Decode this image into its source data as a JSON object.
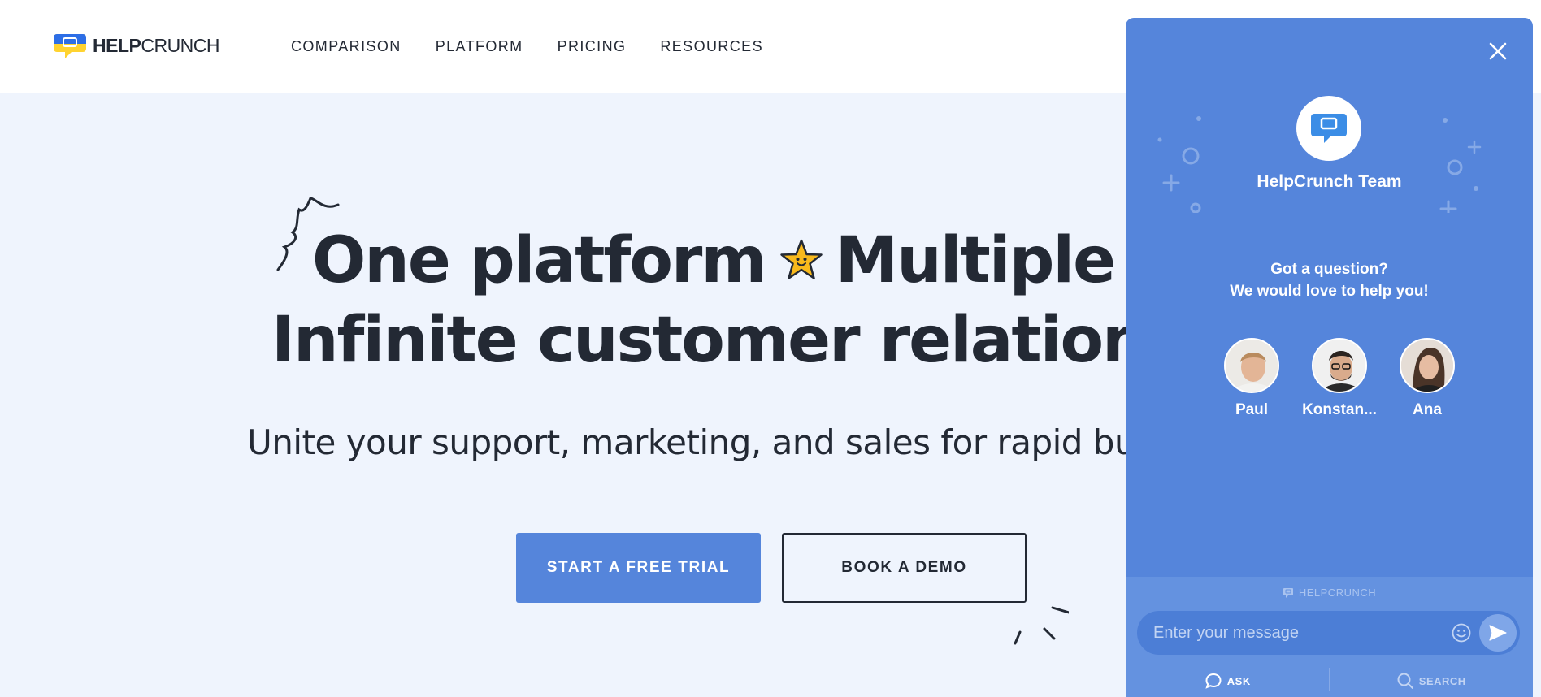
{
  "header": {
    "logo_bold": "HELP",
    "logo_light": "CRUNCH",
    "nav": [
      {
        "label": "COMPARISON"
      },
      {
        "label": "PLATFORM"
      },
      {
        "label": "PRICING"
      },
      {
        "label": "RESOURCES"
      }
    ]
  },
  "hero": {
    "title_line1_a": "One platform",
    "title_line1_b": "Multiple to",
    "title_line2": "Infinite customer relationsh",
    "subtitle": "Unite your support, marketing, and sales for rapid busine",
    "primary_cta": "START A FREE TRIAL",
    "secondary_cta": "BOOK A DEMO"
  },
  "widget": {
    "team_name": "HelpCrunch Team",
    "question_line1": "Got a question?",
    "question_line2": "We would love to help you!",
    "agents": [
      {
        "name": "Paul"
      },
      {
        "name": "Konstan..."
      },
      {
        "name": "Ana"
      }
    ],
    "powered_by": "HELPCRUNCH",
    "message_placeholder": "Enter your message",
    "tabs": {
      "ask": "ASK",
      "search": "SEARCH"
    }
  },
  "colors": {
    "brand_blue": "#5585db",
    "text_dark": "#232934",
    "hero_bg": "#eff4fd",
    "logo_yellow": "#ffd330",
    "star_yellow": "#f8b91c"
  }
}
